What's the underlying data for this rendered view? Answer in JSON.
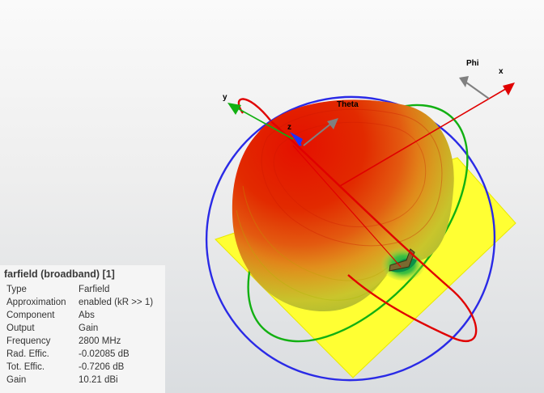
{
  "viewport": {
    "axes": {
      "x": "x",
      "y": "y",
      "z": "z",
      "theta": "Theta",
      "phi": "Phi"
    }
  },
  "info_panel": {
    "title": "farfield (broadband) [1]",
    "rows": [
      {
        "label": "Type",
        "value": "Farfield"
      },
      {
        "label": "Approximation",
        "value": "enabled (kR >> 1)"
      },
      {
        "label": "Component",
        "value": "Abs"
      },
      {
        "label": "Output",
        "value": "Gain"
      },
      {
        "label": "Frequency",
        "value": "2800 MHz"
      },
      {
        "label": "Rad. Effic.",
        "value": "-0.02085 dB"
      },
      {
        "label": "Tot. Effic.",
        "value": "-0.7206 dB"
      },
      {
        "label": "Gain",
        "value": "10.21 dBi"
      }
    ]
  },
  "colors": {
    "ground_plane": "#ffff33",
    "x_axis": "#e00000",
    "y_axis": "#00b000",
    "z_axis": "#1a33ff",
    "theta_phi_arrows": "#808080",
    "pattern_max": "#e00000",
    "pattern_min": "#00b030"
  }
}
